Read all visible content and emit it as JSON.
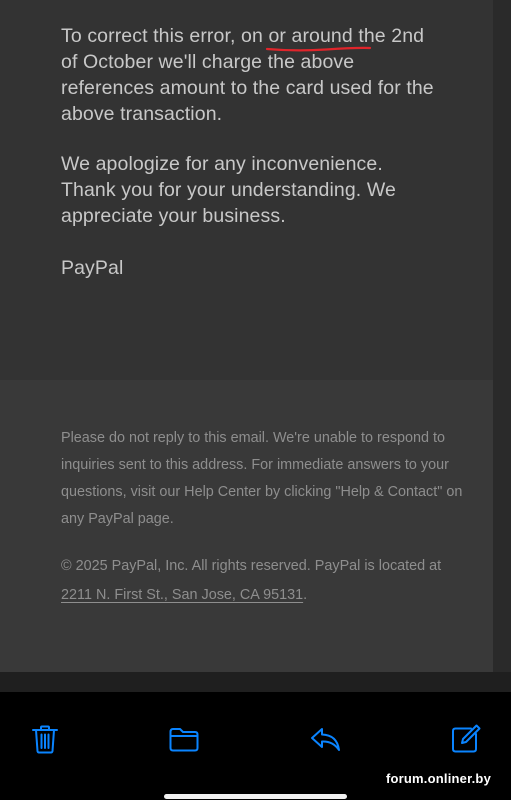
{
  "email": {
    "paragraph1_before": "To correct this error, on ",
    "paragraph1_marked": "or around t",
    "paragraph1_after": "he 2nd of October we'll charge the above references amount to the card used for the above transaction.",
    "paragraph2": "We apologize for any inconvenience. Thank you for your understanding. We appreciate your business.",
    "signature": "PayPal"
  },
  "footer": {
    "notice": "Please do not reply to this email. We're unable to respond to inquiries sent to this address. For immediate answers to your questions, visit our Help Center by clicking \"Help & Contact\" on any PayPal page.",
    "copyright": "© 2025 PayPal, Inc. All rights reserved. PayPal is located at ",
    "address": "2211 N. First St., San Jose, CA 95131",
    "address_end": "."
  },
  "toolbar": {
    "icons": [
      "trash-icon",
      "folder-icon",
      "reply-icon",
      "compose-icon"
    ],
    "icon_color": "#0a84ff"
  },
  "watermark": "forum.onliner.by",
  "colors": {
    "body_background": "#333333",
    "footer_background": "#393939",
    "annotation_underline": "#e0252b"
  }
}
